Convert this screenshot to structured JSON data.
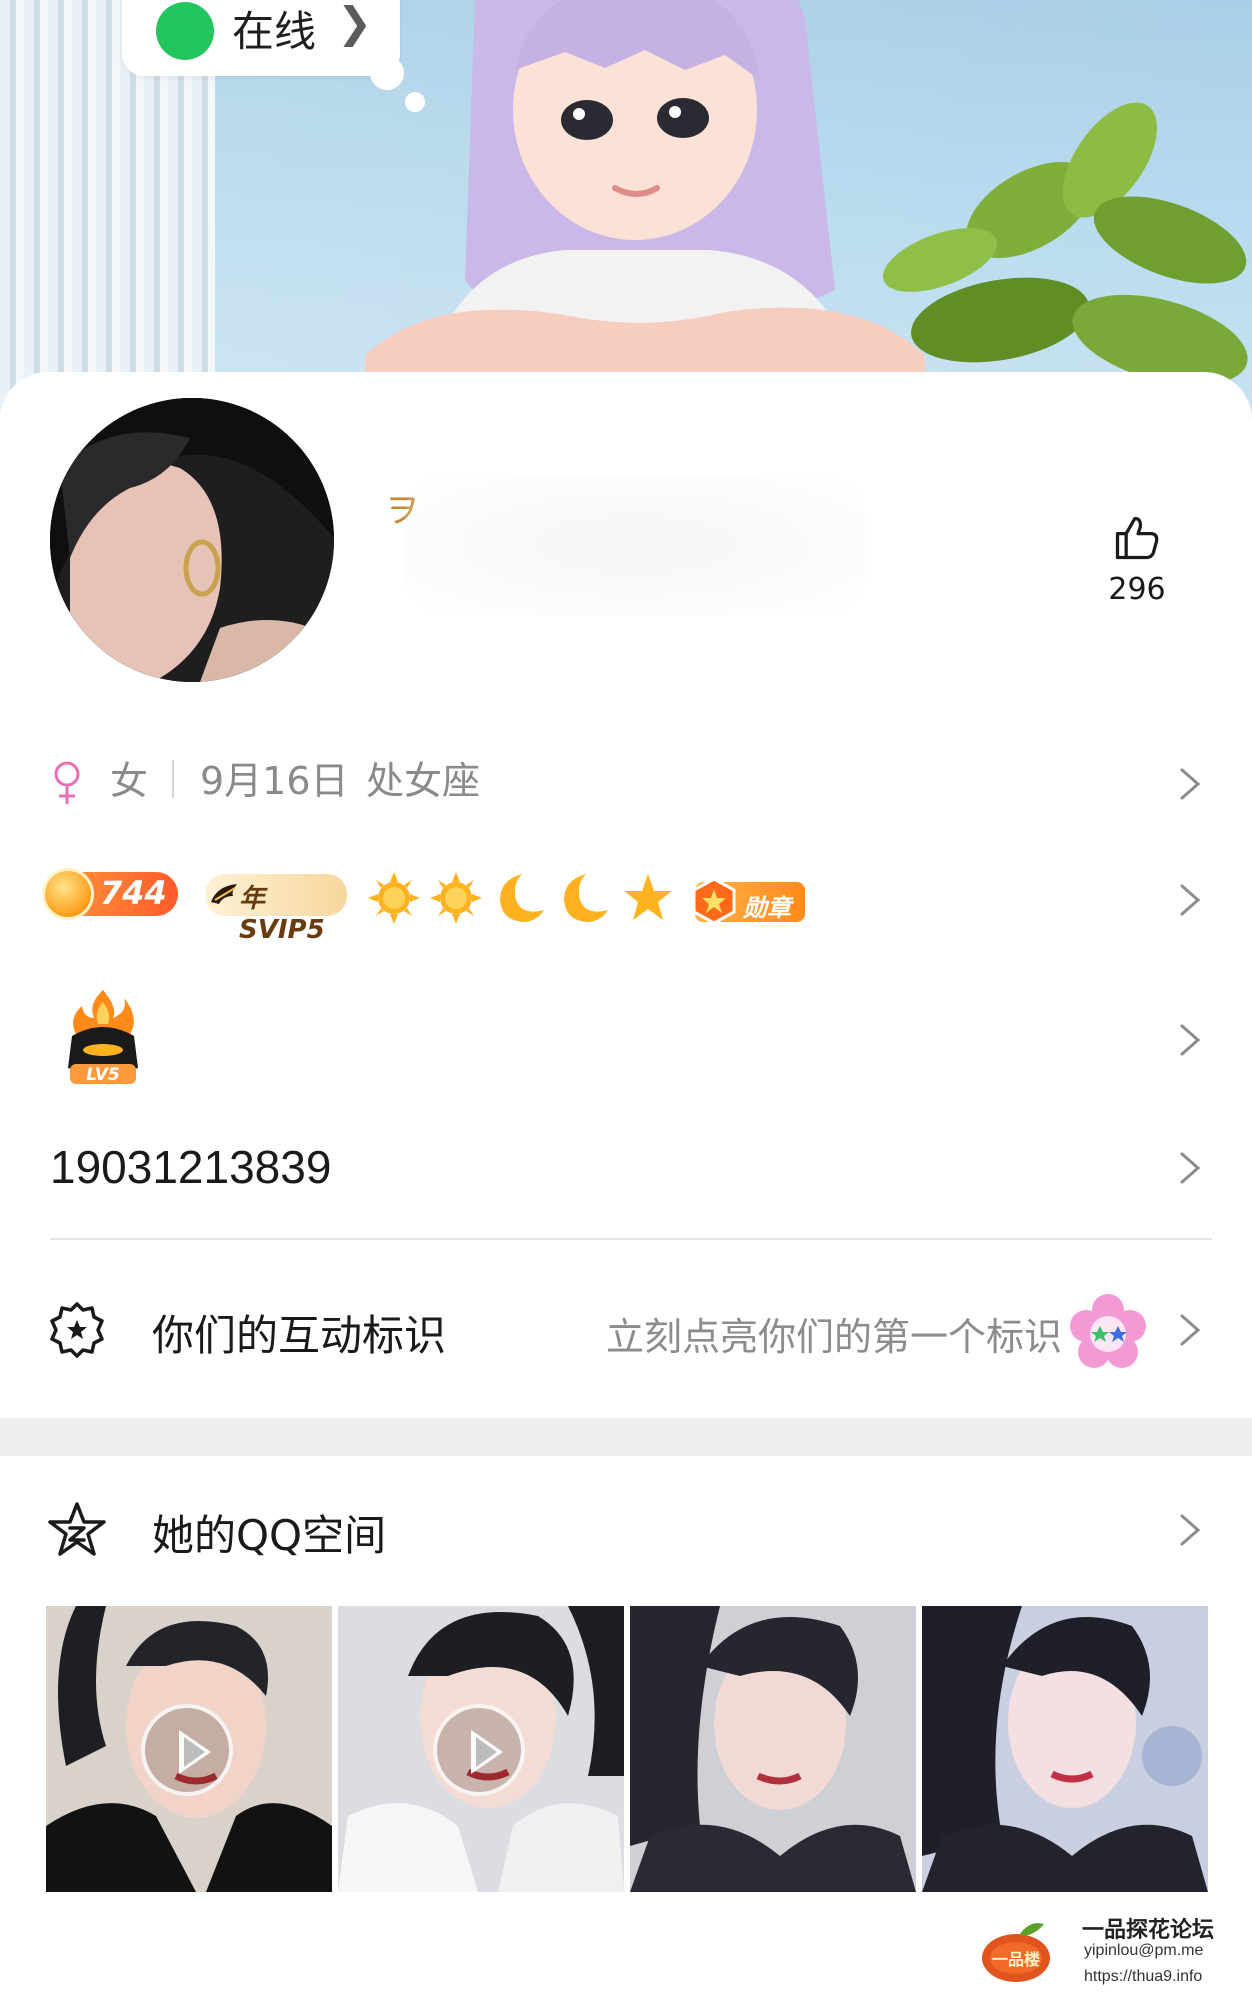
{
  "header": {
    "status": {
      "label": "在线",
      "dot_color": "#22c55e"
    }
  },
  "profile": {
    "name_fragment": "ヲ",
    "likes": "296"
  },
  "info": {
    "gender": "女",
    "birthday": "9月16日",
    "zodiac": "处女座",
    "gender_color": "#e86fb6"
  },
  "badges": {
    "level_value": "744",
    "svip_label": "年SVIP5",
    "medal_label": "勋章",
    "icons": [
      "sun-icon",
      "sun-icon",
      "moon-icon",
      "moon-icon",
      "star-icon"
    ]
  },
  "level_icon": {
    "label": "LV5"
  },
  "account": {
    "qq_number": "19031213839"
  },
  "interaction": {
    "title": "你们的互动标识",
    "hint": "立刻点亮你们的第一个标识"
  },
  "qzone": {
    "title": "她的QQ空间",
    "photos": [
      {
        "is_video": true
      },
      {
        "is_video": true
      },
      {
        "is_video": false
      },
      {
        "is_video": false
      }
    ]
  },
  "watermark": {
    "logo_text": "一品楼",
    "title": "一品探花论坛",
    "email": "yipinlou@pm.me",
    "url": "https://thua9.info"
  }
}
